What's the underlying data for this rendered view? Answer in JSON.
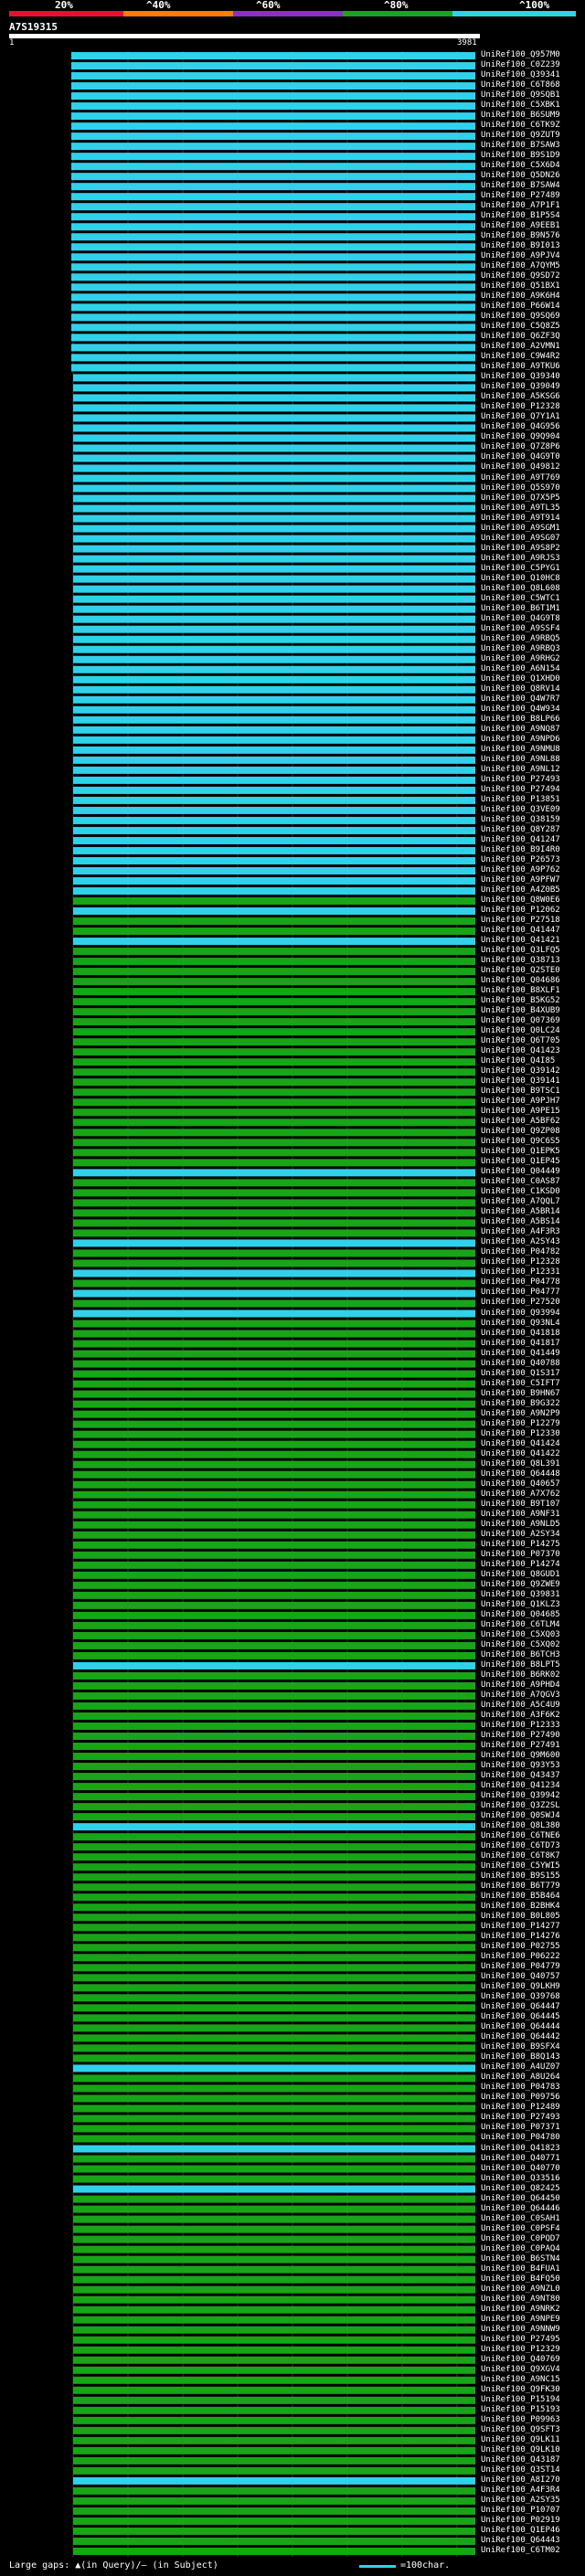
{
  "header": {
    "scale_labels": [
      "20%",
      "^40%",
      "^60%",
      "^80%",
      "^100%"
    ],
    "scale_colors": [
      "#e8112d",
      "#ff7d00",
      "#8b2fc9",
      "#18a518",
      "#2fd2ea"
    ],
    "query_id": "A7S19315",
    "start": "1",
    "end": "3981"
  },
  "hits": [
    {
      "id": "UniRef100_Q957M0",
      "color": "#2fd2ea"
    },
    {
      "id": "UniRef100_C0Z239",
      "color": "#2fd2ea"
    },
    {
      "id": "UniRef100_Q39341",
      "color": "#2fd2ea"
    },
    {
      "id": "UniRef100_C6T868",
      "color": "#2fd2ea"
    },
    {
      "id": "UniRef100_Q9SQB1",
      "color": "#2fd2ea"
    },
    {
      "id": "UniRef100_C5XBK1",
      "color": "#2fd2ea"
    },
    {
      "id": "UniRef100_B6SUM9",
      "color": "#2fd2ea"
    },
    {
      "id": "UniRef100_C6TK9Z",
      "color": "#2fd2ea"
    },
    {
      "id": "UniRef100_Q9ZUT9",
      "color": "#2fd2ea"
    },
    {
      "id": "UniRef100_B7SAW3",
      "color": "#2fd2ea"
    },
    {
      "id": "UniRef100_B9S1D9",
      "color": "#2fd2ea"
    },
    {
      "id": "UniRef100_C5X6D4",
      "color": "#2fd2ea"
    },
    {
      "id": "UniRef100_Q5DN26",
      "color": "#2fd2ea"
    },
    {
      "id": "UniRef100_B7SAW4",
      "color": "#2fd2ea"
    },
    {
      "id": "UniRef100_P27489",
      "color": "#2fd2ea"
    },
    {
      "id": "UniRef100_A7P1F1",
      "color": "#2fd2ea"
    },
    {
      "id": "UniRef100_B1P5S4",
      "color": "#2fd2ea"
    },
    {
      "id": "UniRef100_A9EEB1",
      "color": "#2fd2ea"
    },
    {
      "id": "UniRef100_B9N576",
      "color": "#2fd2ea"
    },
    {
      "id": "UniRef100_B9I013",
      "color": "#2fd2ea"
    },
    {
      "id": "UniRef100_A9PJV4",
      "color": "#2fd2ea"
    },
    {
      "id": "UniRef100_A7QYM5",
      "color": "#2fd2ea"
    },
    {
      "id": "UniRef100_Q9SD72",
      "color": "#2fd2ea"
    },
    {
      "id": "UniRef100_Q51BX1",
      "color": "#2fd2ea"
    },
    {
      "id": "UniRef100_A9K6H4",
      "color": "#2fd2ea"
    },
    {
      "id": "UniRef100_P66W14",
      "color": "#2fd2ea"
    },
    {
      "id": "UniRef100_Q9SQ69",
      "color": "#2fd2ea"
    },
    {
      "id": "UniRef100_C5Q8Z5",
      "color": "#2fd2ea"
    },
    {
      "id": "UniRef100_Q6ZF3Q",
      "color": "#2fd2ea"
    },
    {
      "id": "UniRef100_A2VMN1",
      "color": "#2fd2ea"
    },
    {
      "id": "UniRef100_C9W4R2",
      "color": "#2fd2ea"
    },
    {
      "id": "UniRef100_A9TKU6",
      "color": "#2fd2ea"
    },
    {
      "id": "UniRef100_Q39340",
      "color": "#2fd2ea"
    },
    {
      "id": "UniRef100_Q39049",
      "color": "#2fd2ea"
    },
    {
      "id": "UniRef100_A5KSG6",
      "color": "#2fd2ea"
    },
    {
      "id": "UniRef100_P12328",
      "color": "#2fd2ea"
    },
    {
      "id": "UniRef100_Q7Y1A1",
      "color": "#2fd2ea"
    },
    {
      "id": "UniRef100_Q4G956",
      "color": "#2fd2ea"
    },
    {
      "id": "UniRef100_Q9Q904",
      "color": "#2fd2ea"
    },
    {
      "id": "UniRef100_Q7Z8P6",
      "color": "#2fd2ea"
    },
    {
      "id": "UniRef100_Q4G9T0",
      "color": "#2fd2ea"
    },
    {
      "id": "UniRef100_Q49812",
      "color": "#2fd2ea"
    },
    {
      "id": "UniRef100_A9T769",
      "color": "#2fd2ea"
    },
    {
      "id": "UniRef100_Q5S970",
      "color": "#2fd2ea"
    },
    {
      "id": "UniRef100_Q7X5P5",
      "color": "#2fd2ea"
    },
    {
      "id": "UniRef100_A9TL35",
      "color": "#2fd2ea"
    },
    {
      "id": "UniRef100_A9T914",
      "color": "#2fd2ea"
    },
    {
      "id": "UniRef100_A9SGM1",
      "color": "#2fd2ea"
    },
    {
      "id": "UniRef100_A9SG07",
      "color": "#2fd2ea"
    },
    {
      "id": "UniRef100_A9S8P2",
      "color": "#2fd2ea"
    },
    {
      "id": "UniRef100_A9RJS3",
      "color": "#2fd2ea"
    },
    {
      "id": "UniRef100_C5PYG1",
      "color": "#2fd2ea"
    },
    {
      "id": "UniRef100_Q10HC8",
      "color": "#2fd2ea"
    },
    {
      "id": "UniRef100_Q8L608",
      "color": "#2fd2ea"
    },
    {
      "id": "UniRef100_C5WTC1",
      "color": "#2fd2ea"
    },
    {
      "id": "UniRef100_B6T1M1",
      "color": "#2fd2ea"
    },
    {
      "id": "UniRef100_Q4G9T8",
      "color": "#2fd2ea"
    },
    {
      "id": "UniRef100_A9SSF4",
      "color": "#2fd2ea"
    },
    {
      "id": "UniRef100_A9RBQ5",
      "color": "#2fd2ea"
    },
    {
      "id": "UniRef100_A9RBQ3",
      "color": "#2fd2ea"
    },
    {
      "id": "UniRef100_A9RHG2",
      "color": "#2fd2ea"
    },
    {
      "id": "UniRef100_A6N154",
      "color": "#2fd2ea"
    },
    {
      "id": "UniRef100_Q1XHD0",
      "color": "#2fd2ea"
    },
    {
      "id": "UniRef100_Q8RV14",
      "color": "#2fd2ea"
    },
    {
      "id": "UniRef100_Q4W7R7",
      "color": "#2fd2ea"
    },
    {
      "id": "UniRef100_Q4W934",
      "color": "#2fd2ea"
    },
    {
      "id": "UniRef100_B8LP66",
      "color": "#2fd2ea"
    },
    {
      "id": "UniRef100_A9NQ87",
      "color": "#2fd2ea"
    },
    {
      "id": "UniRef100_A9NPD6",
      "color": "#2fd2ea"
    },
    {
      "id": "UniRef100_A9NMU8",
      "color": "#2fd2ea"
    },
    {
      "id": "UniRef100_A9NL88",
      "color": "#2fd2ea"
    },
    {
      "id": "UniRef100_A9NL12",
      "color": "#2fd2ea"
    },
    {
      "id": "UniRef100_P27493",
      "color": "#2fd2ea"
    },
    {
      "id": "UniRef100_P27494",
      "color": "#2fd2ea"
    },
    {
      "id": "UniRef100_P13851",
      "color": "#2fd2ea"
    },
    {
      "id": "UniRef100_Q3VE09",
      "color": "#2fd2ea"
    },
    {
      "id": "UniRef100_Q38159",
      "color": "#2fd2ea"
    },
    {
      "id": "UniRef100_Q8Y287",
      "color": "#2fd2ea"
    },
    {
      "id": "UniRef100_Q41247",
      "color": "#2fd2ea"
    },
    {
      "id": "UniRef100_B9I4R0",
      "color": "#2fd2ea"
    },
    {
      "id": "UniRef100_P26573",
      "color": "#2fd2ea"
    },
    {
      "id": "UniRef100_A9P762",
      "color": "#2fd2ea"
    },
    {
      "id": "UniRef100_A9PFW7",
      "color": "#2fd2ea"
    },
    {
      "id": "UniRef100_A4Z0B5",
      "color": "#2fd2ea"
    },
    {
      "id": "UniRef100_Q8W0E6",
      "color": "#18a518"
    },
    {
      "id": "UniRef100_P12062",
      "color": "#2fd2ea"
    },
    {
      "id": "UniRef100_P27518",
      "color": "#18a518"
    },
    {
      "id": "UniRef100_Q41447",
      "color": "#18a518"
    },
    {
      "id": "UniRef100_Q41421",
      "color": "#2fd2ea"
    },
    {
      "id": "UniRef100_Q3LFQ5",
      "color": "#18a518"
    },
    {
      "id": "UniRef100_Q38713",
      "color": "#18a518"
    },
    {
      "id": "UniRef100_Q2STE0",
      "color": "#18a518"
    },
    {
      "id": "UniRef100_Q04686",
      "color": "#18a518"
    },
    {
      "id": "UniRef100_B8XLF1",
      "color": "#18a518"
    },
    {
      "id": "UniRef100_B5KG52",
      "color": "#18a518"
    },
    {
      "id": "UniRef100_B4XUB9",
      "color": "#18a518"
    },
    {
      "id": "UniRef100_Q07369",
      "color": "#18a518"
    },
    {
      "id": "UniRef100_Q0LC24",
      "color": "#18a518"
    },
    {
      "id": "UniRef100_Q6T705",
      "color": "#18a518"
    },
    {
      "id": "UniRef100_Q41423",
      "color": "#18a518"
    },
    {
      "id": "UniRef100_Q4I85",
      "color": "#18a518"
    },
    {
      "id": "UniRef100_Q39142",
      "color": "#18a518"
    },
    {
      "id": "UniRef100_Q39141",
      "color": "#18a518"
    },
    {
      "id": "UniRef100_B9TSC1",
      "color": "#18a518"
    },
    {
      "id": "UniRef100_A9PJH7",
      "color": "#18a518"
    },
    {
      "id": "UniRef100_A9PE15",
      "color": "#18a518"
    },
    {
      "id": "UniRef100_A5BF62",
      "color": "#18a518"
    },
    {
      "id": "UniRef100_Q9ZP08",
      "color": "#18a518"
    },
    {
      "id": "UniRef100_Q9C6S5",
      "color": "#18a518"
    },
    {
      "id": "UniRef100_Q1EPK5",
      "color": "#18a518"
    },
    {
      "id": "UniRef100_Q1EP45",
      "color": "#18a518"
    },
    {
      "id": "UniRef100_Q04449",
      "color": "#2fd2ea"
    },
    {
      "id": "UniRef100_C0AS87",
      "color": "#18a518"
    },
    {
      "id": "UniRef100_C1KSD0",
      "color": "#18a518"
    },
    {
      "id": "UniRef100_A7QQL7",
      "color": "#18a518"
    },
    {
      "id": "UniRef100_A5BR14",
      "color": "#18a518"
    },
    {
      "id": "UniRef100_A5BS14",
      "color": "#18a518"
    },
    {
      "id": "UniRef100_A4F3R3",
      "color": "#18a518"
    },
    {
      "id": "UniRef100_A2SY43",
      "color": "#2fd2ea"
    },
    {
      "id": "UniRef100_P04782",
      "color": "#18a518"
    },
    {
      "id": "UniRef100_P12328",
      "color": "#18a518"
    },
    {
      "id": "UniRef100_P12331",
      "color": "#2fd2ea"
    },
    {
      "id": "UniRef100_P04778",
      "color": "#18a518"
    },
    {
      "id": "UniRef100_P04777",
      "color": "#2fd2ea"
    },
    {
      "id": "UniRef100_P27520",
      "color": "#18a518"
    },
    {
      "id": "UniRef100_Q93994",
      "color": "#2fd2ea"
    },
    {
      "id": "UniRef100_Q93NL4",
      "color": "#18a518"
    },
    {
      "id": "UniRef100_Q41818",
      "color": "#18a518"
    },
    {
      "id": "UniRef100_Q41817",
      "color": "#18a518"
    },
    {
      "id": "UniRef100_Q41449",
      "color": "#18a518"
    },
    {
      "id": "UniRef100_Q40788",
      "color": "#18a518"
    },
    {
      "id": "UniRef100_Q1S317",
      "color": "#18a518"
    },
    {
      "id": "UniRef100_C5IFT7",
      "color": "#18a518"
    },
    {
      "id": "UniRef100_B9HN67",
      "color": "#18a518"
    },
    {
      "id": "UniRef100_B9G322",
      "color": "#18a518"
    },
    {
      "id": "UniRef100_A9N2P9",
      "color": "#18a518"
    },
    {
      "id": "UniRef100_P12279",
      "color": "#18a518"
    },
    {
      "id": "UniRef100_P12330",
      "color": "#18a518"
    },
    {
      "id": "UniRef100_Q41424",
      "color": "#18a518"
    },
    {
      "id": "UniRef100_Q41422",
      "color": "#18a518"
    },
    {
      "id": "UniRef100_Q8L391",
      "color": "#18a518"
    },
    {
      "id": "UniRef100_Q64448",
      "color": "#18a518"
    },
    {
      "id": "UniRef100_Q40657",
      "color": "#18a518"
    },
    {
      "id": "UniRef100_A7X762",
      "color": "#18a518"
    },
    {
      "id": "UniRef100_B9T107",
      "color": "#18a518"
    },
    {
      "id": "UniRef100_A9NF31",
      "color": "#18a518"
    },
    {
      "id": "UniRef100_A9NLD5",
      "color": "#18a518"
    },
    {
      "id": "UniRef100_A2SY34",
      "color": "#18a518"
    },
    {
      "id": "UniRef100_P14275",
      "color": "#18a518"
    },
    {
      "id": "UniRef100_P07370",
      "color": "#18a518"
    },
    {
      "id": "UniRef100_P14274",
      "color": "#18a518"
    },
    {
      "id": "UniRef100_Q8GUD1",
      "color": "#18a518"
    },
    {
      "id": "UniRef100_Q9ZWE9",
      "color": "#18a518"
    },
    {
      "id": "UniRef100_Q39831",
      "color": "#18a518"
    },
    {
      "id": "UniRef100_Q1KLZ3",
      "color": "#18a518"
    },
    {
      "id": "UniRef100_Q04685",
      "color": "#18a518"
    },
    {
      "id": "UniRef100_C6TLM4",
      "color": "#18a518"
    },
    {
      "id": "UniRef100_C5XQ03",
      "color": "#18a518"
    },
    {
      "id": "UniRef100_C5XQ02",
      "color": "#18a518"
    },
    {
      "id": "UniRef100_B6TCH3",
      "color": "#18a518"
    },
    {
      "id": "UniRef100_B8LPT5",
      "color": "#2fd2ea"
    },
    {
      "id": "UniRef100_B6RK02",
      "color": "#18a518"
    },
    {
      "id": "UniRef100_A9PHD4",
      "color": "#18a518"
    },
    {
      "id": "UniRef100_A7QGV3",
      "color": "#18a518"
    },
    {
      "id": "UniRef100_A5C4U9",
      "color": "#18a518"
    },
    {
      "id": "UniRef100_A3F6K2",
      "color": "#18a518"
    },
    {
      "id": "UniRef100_P12333",
      "color": "#18a518"
    },
    {
      "id": "UniRef100_P27490",
      "color": "#18a518"
    },
    {
      "id": "UniRef100_P27491",
      "color": "#18a518"
    },
    {
      "id": "UniRef100_Q9M600",
      "color": "#18a518"
    },
    {
      "id": "UniRef100_Q93Y53",
      "color": "#18a518"
    },
    {
      "id": "UniRef100_Q43437",
      "color": "#18a518"
    },
    {
      "id": "UniRef100_Q41234",
      "color": "#18a518"
    },
    {
      "id": "UniRef100_Q39942",
      "color": "#18a518"
    },
    {
      "id": "UniRef100_Q3Z2SL",
      "color": "#18a518"
    },
    {
      "id": "UniRef100_Q0SWJ4",
      "color": "#18a518"
    },
    {
      "id": "UniRef100_Q8L380",
      "color": "#2fd2ea"
    },
    {
      "id": "UniRef100_C6TNE6",
      "color": "#18a518"
    },
    {
      "id": "UniRef100_C6TD73",
      "color": "#18a518"
    },
    {
      "id": "UniRef100_C6T8K7",
      "color": "#18a518"
    },
    {
      "id": "UniRef100_C5YWI5",
      "color": "#18a518"
    },
    {
      "id": "UniRef100_B9S155",
      "color": "#18a518"
    },
    {
      "id": "UniRef100_B6T779",
      "color": "#18a518"
    },
    {
      "id": "UniRef100_B5B464",
      "color": "#18a518"
    },
    {
      "id": "UniRef100_B2BHK4",
      "color": "#18a518"
    },
    {
      "id": "UniRef100_B0L805",
      "color": "#18a518"
    },
    {
      "id": "UniRef100_P14277",
      "color": "#18a518"
    },
    {
      "id": "UniRef100_P14276",
      "color": "#18a518"
    },
    {
      "id": "UniRef100_P02755",
      "color": "#18a518"
    },
    {
      "id": "UniRef100_P06222",
      "color": "#18a518"
    },
    {
      "id": "UniRef100_P04779",
      "color": "#18a518"
    },
    {
      "id": "UniRef100_Q40757",
      "color": "#18a518"
    },
    {
      "id": "UniRef100_Q9LKH9",
      "color": "#18a518"
    },
    {
      "id": "UniRef100_Q39768",
      "color": "#18a518"
    },
    {
      "id": "UniRef100_Q64447",
      "color": "#18a518"
    },
    {
      "id": "UniRef100_Q64445",
      "color": "#18a518"
    },
    {
      "id": "UniRef100_Q64444",
      "color": "#18a518"
    },
    {
      "id": "UniRef100_Q64442",
      "color": "#18a518"
    },
    {
      "id": "UniRef100_B9SFX4",
      "color": "#18a518"
    },
    {
      "id": "UniRef100_B8Q143",
      "color": "#18a518"
    },
    {
      "id": "UniRef100_A4UZ07",
      "color": "#2fd2ea"
    },
    {
      "id": "UniRef100_A8U264",
      "color": "#18a518"
    },
    {
      "id": "UniRef100_P04783",
      "color": "#18a518"
    },
    {
      "id": "UniRef100_P09756",
      "color": "#18a518"
    },
    {
      "id": "UniRef100_P12489",
      "color": "#18a518"
    },
    {
      "id": "UniRef100_P27493",
      "color": "#18a518"
    },
    {
      "id": "UniRef100_P07371",
      "color": "#18a518"
    },
    {
      "id": "UniRef100_P04780",
      "color": "#18a518"
    },
    {
      "id": "UniRef100_Q41823",
      "color": "#2fd2ea"
    },
    {
      "id": "UniRef100_Q40771",
      "color": "#18a518"
    },
    {
      "id": "UniRef100_Q40770",
      "color": "#18a518"
    },
    {
      "id": "UniRef100_Q33516",
      "color": "#18a518"
    },
    {
      "id": "UniRef100_Q82425",
      "color": "#2fd2ea"
    },
    {
      "id": "UniRef100_Q64450",
      "color": "#18a518"
    },
    {
      "id": "UniRef100_Q64446",
      "color": "#18a518"
    },
    {
      "id": "UniRef100_C0SAH1",
      "color": "#18a518"
    },
    {
      "id": "UniRef100_C0PSF4",
      "color": "#18a518"
    },
    {
      "id": "UniRef100_C0PQD7",
      "color": "#18a518"
    },
    {
      "id": "UniRef100_C0PAQ4",
      "color": "#18a518"
    },
    {
      "id": "UniRef100_B6STN4",
      "color": "#18a518"
    },
    {
      "id": "UniRef100_B4FUA1",
      "color": "#18a518"
    },
    {
      "id": "UniRef100_B4FQ50",
      "color": "#18a518"
    },
    {
      "id": "UniRef100_A9NZL0",
      "color": "#18a518"
    },
    {
      "id": "UniRef100_A9NT80",
      "color": "#18a518"
    },
    {
      "id": "UniRef100_A9NRK2",
      "color": "#18a518"
    },
    {
      "id": "UniRef100_A9NPE9",
      "color": "#18a518"
    },
    {
      "id": "UniRef100_A9NNW9",
      "color": "#18a518"
    },
    {
      "id": "UniRef100_P27495",
      "color": "#18a518"
    },
    {
      "id": "UniRef100_P12329",
      "color": "#18a518"
    },
    {
      "id": "UniRef100_Q40769",
      "color": "#18a518"
    },
    {
      "id": "UniRef100_Q9XGV4",
      "color": "#18a518"
    },
    {
      "id": "UniRef100_A9NC15",
      "color": "#18a518"
    },
    {
      "id": "UniRef100_Q9FK30",
      "color": "#18a518"
    },
    {
      "id": "UniRef100_P15194",
      "color": "#18a518"
    },
    {
      "id": "UniRef100_P15193",
      "color": "#18a518"
    },
    {
      "id": "UniRef100_P09963",
      "color": "#18a518"
    },
    {
      "id": "UniRef100_Q9SFT3",
      "color": "#18a518"
    },
    {
      "id": "UniRef100_Q9LK11",
      "color": "#18a518"
    },
    {
      "id": "UniRef100_Q9LK10",
      "color": "#18a518"
    },
    {
      "id": "UniRef100_Q43187",
      "color": "#18a518"
    },
    {
      "id": "UniRef100_Q3ST14",
      "color": "#18a518"
    },
    {
      "id": "UniRef100_A8I270",
      "color": "#2fd2ea"
    },
    {
      "id": "UniRef100_A4F3R4",
      "color": "#18a518"
    },
    {
      "id": "UniRef100_A2SY35",
      "color": "#18a518"
    },
    {
      "id": "UniRef100_P10707",
      "color": "#18a518"
    },
    {
      "id": "UniRef100_P02919",
      "color": "#18a518"
    },
    {
      "id": "UniRef100_Q1EP46",
      "color": "#18a518"
    },
    {
      "id": "UniRef100_Q64443",
      "color": "#18a518"
    },
    {
      "id": "UniRef100_C6TM02",
      "color": "#18a518"
    }
  ],
  "legend": {
    "large_gaps": "Large gaps: ▲(in Query)/– (in Subject)",
    "scale_note": "=100char."
  }
}
